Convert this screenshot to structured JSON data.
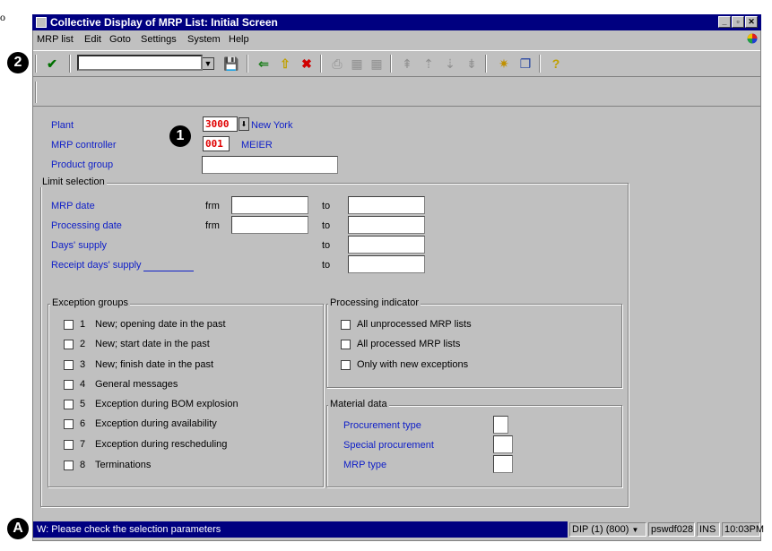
{
  "window": {
    "title": "Collective Display of MRP List: Initial Screen"
  },
  "stray_char": "o",
  "menu": {
    "items": [
      "MRP list",
      "Edit",
      "Goto",
      "Settings",
      "System",
      "Help"
    ]
  },
  "toolbar": {
    "command_field_value": ""
  },
  "callouts": {
    "one": "1",
    "two": "2",
    "a": "A"
  },
  "header_fields": {
    "plant_label": "Plant",
    "plant_value": "3000",
    "plant_desc": "New York",
    "mrp_controller_label": "MRP controller",
    "mrp_controller_value": "001",
    "mrp_controller_desc": "MEIER",
    "product_group_label": "Product group",
    "product_group_value": ""
  },
  "limit_selection": {
    "title": "Limit selection",
    "rows": [
      {
        "label": "MRP date",
        "from": "frm",
        "to": "to",
        "from_value": "",
        "to_value": ""
      },
      {
        "label": "Processing date",
        "from": "frm",
        "to": "to",
        "from_value": "",
        "to_value": ""
      },
      {
        "label": "Days' supply",
        "to": "to",
        "to_value": ""
      },
      {
        "label": "Receipt days' supply",
        "to": "to",
        "to_value": ""
      }
    ]
  },
  "exception_groups": {
    "title": "Exception groups",
    "items": [
      {
        "num": "1",
        "label": "New; opening date in the past"
      },
      {
        "num": "2",
        "label": "New; start date in the past"
      },
      {
        "num": "3",
        "label": "New; finish date in the past"
      },
      {
        "num": "4",
        "label": "General messages"
      },
      {
        "num": "5",
        "label": "Exception during BOM explosion"
      },
      {
        "num": "6",
        "label": "Exception during availability"
      },
      {
        "num": "7",
        "label": "Exception during rescheduling"
      },
      {
        "num": "8",
        "label": "Terminations"
      }
    ]
  },
  "processing_indicator": {
    "title": "Processing indicator",
    "items": [
      "All unprocessed MRP lists",
      "All processed MRP lists",
      "Only with new exceptions"
    ]
  },
  "material_data": {
    "title": "Material data",
    "items": [
      {
        "label": "Procurement type",
        "value": ""
      },
      {
        "label": "Special procurement",
        "value": ""
      },
      {
        "label": "MRP type",
        "value": ""
      }
    ]
  },
  "status": {
    "message": "W: Please check the selection parameters",
    "system": "DIP (1) (800)",
    "server": "pswdf028",
    "mode": "INS",
    "time": "10:03PM"
  },
  "colors": {
    "title_bar": "#000080",
    "field_label_blue": "#1020c8",
    "required_value_red": "#e00000",
    "background": "#c0c0c0"
  }
}
